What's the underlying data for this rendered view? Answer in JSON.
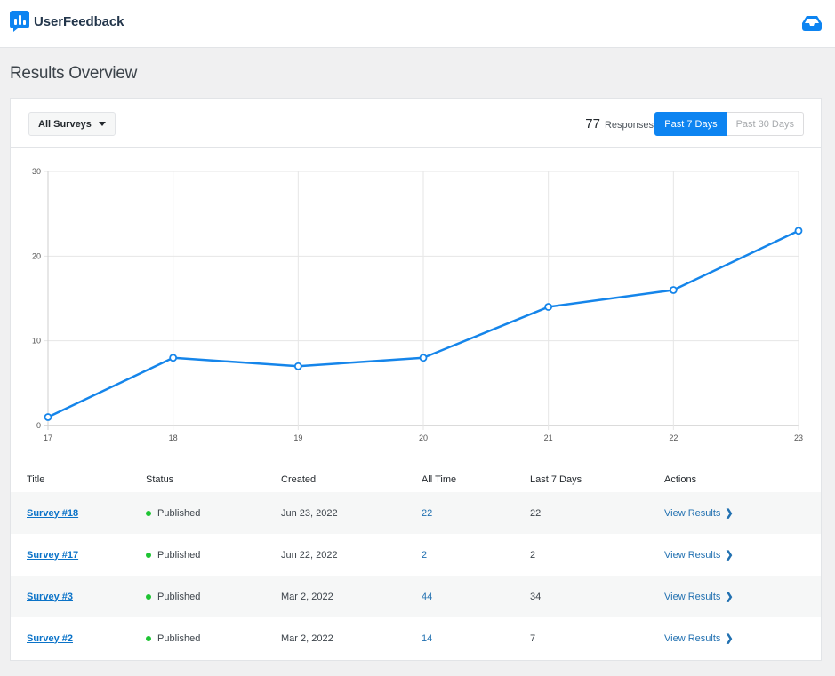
{
  "app": {
    "name": "UserFeedback",
    "brand_color": "#0d84f1"
  },
  "header": {
    "inbox_icon": "inbox-tray-icon"
  },
  "page": {
    "title": "Results Overview"
  },
  "filters": {
    "survey_select": "All Surveys",
    "responses_count": "77",
    "responses_label": "Responses",
    "ranges": [
      {
        "label": "Past 7 Days",
        "active": true
      },
      {
        "label": "Past 30 Days",
        "active": false
      }
    ]
  },
  "chart_data": {
    "type": "line",
    "title": "",
    "xlabel": "",
    "ylabel": "",
    "categories": [
      "17",
      "18",
      "19",
      "20",
      "21",
      "22",
      "23"
    ],
    "series": [
      {
        "name": "Responses",
        "values": [
          1,
          8,
          7,
          8,
          14,
          16,
          23
        ],
        "color": "#1585ea"
      }
    ],
    "ylim": [
      0,
      30
    ],
    "yticks": [
      0,
      10,
      20,
      30
    ],
    "grid": true,
    "legend": "none"
  },
  "table": {
    "columns": [
      "Title",
      "Status",
      "Created",
      "All Time",
      "Last 7 Days",
      "Actions"
    ],
    "rows": [
      {
        "title": "Survey #18",
        "status": "Published",
        "created": "Jun 23, 2022",
        "all_time": "22",
        "last7": "22",
        "action": "View Results"
      },
      {
        "title": "Survey #17",
        "status": "Published",
        "created": "Jun 22, 2022",
        "all_time": "2",
        "last7": "2",
        "action": "View Results"
      },
      {
        "title": "Survey #3",
        "status": "Published",
        "created": "Mar 2, 2022",
        "all_time": "44",
        "last7": "34",
        "action": "View Results"
      },
      {
        "title": "Survey #2",
        "status": "Published",
        "created": "Mar 2, 2022",
        "all_time": "14",
        "last7": "7",
        "action": "View Results"
      }
    ]
  }
}
